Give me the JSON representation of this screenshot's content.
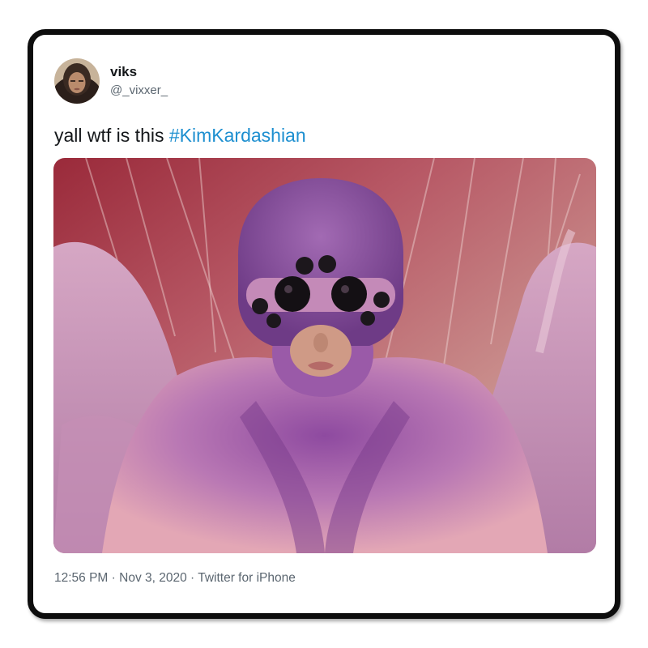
{
  "tweet": {
    "display_name": "viks",
    "handle": "@_vixxer_",
    "text": "yall wtf is this ",
    "hashtag": "#KimKardashian",
    "time": "12:56 PM",
    "separator_1": " · ",
    "date": "Nov 3, 2020",
    "separator_2": " · ",
    "source": "Twitter for iPhone"
  },
  "icons": {
    "avatar": "avatar-photo"
  },
  "colors": {
    "card_border": "#0d0d0d",
    "hashtag": "#1d8fd0",
    "meta_text": "#5b6670",
    "text": "#14171a"
  }
}
